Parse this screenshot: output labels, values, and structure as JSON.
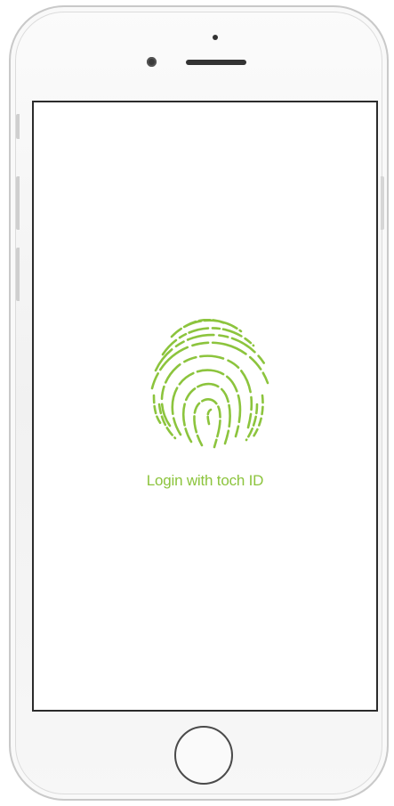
{
  "screen": {
    "login_label": "Login with toch ID"
  },
  "icons": {
    "fingerprint": "fingerprint-icon"
  },
  "colors": {
    "accent": "#8cc43d",
    "screen_border": "#2b2b2b",
    "device_body": "#f4f4f4"
  }
}
